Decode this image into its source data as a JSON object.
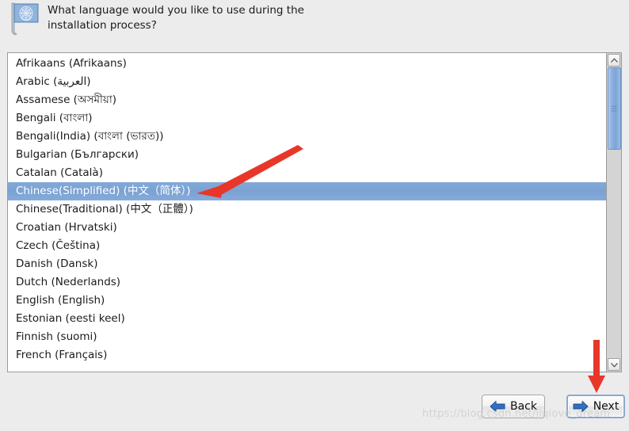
{
  "window": {
    "background_color": "#ececec"
  },
  "header": {
    "icon": "un-flag-icon",
    "prompt": "What language would you like to use during the installation process?"
  },
  "language_list": {
    "name": "language-selection-list",
    "selected_value": "Chinese(Simplified) (中文（简体）)",
    "items": [
      {
        "label": "Afrikaans (Afrikaans)",
        "selected": false
      },
      {
        "label": "Arabic (العربية)",
        "selected": false
      },
      {
        "label": "Assamese (অসমীয়া)",
        "selected": false
      },
      {
        "label": "Bengali (বাংলা)",
        "selected": false
      },
      {
        "label": "Bengali(India) (বাংলা (ভারত))",
        "selected": false
      },
      {
        "label": "Bulgarian (Български)",
        "selected": false
      },
      {
        "label": "Catalan (Català)",
        "selected": false
      },
      {
        "label": "Chinese(Simplified) (中文（简体）)",
        "selected": true
      },
      {
        "label": "Chinese(Traditional) (中文（正體）)",
        "selected": false
      },
      {
        "label": "Croatian (Hrvatski)",
        "selected": false
      },
      {
        "label": "Czech (Čeština)",
        "selected": false
      },
      {
        "label": "Danish (Dansk)",
        "selected": false
      },
      {
        "label": "Dutch (Nederlands)",
        "selected": false
      },
      {
        "label": "English (English)",
        "selected": false
      },
      {
        "label": "Estonian (eesti keel)",
        "selected": false
      },
      {
        "label": "Finnish (suomi)",
        "selected": false
      },
      {
        "label": "French (Français)",
        "selected": false
      }
    ],
    "selection_color": "#7ba2d4"
  },
  "scrollbar": {
    "up_arrow": "chevron-up-icon",
    "down_arrow": "chevron-down-icon",
    "thumb_color": "#7ba4da",
    "position_percent": 0
  },
  "buttons": {
    "back": {
      "label": "Back",
      "icon": "arrow-left-icon"
    },
    "next": {
      "label": "Next",
      "icon": "arrow-right-icon",
      "focused": true
    }
  },
  "annotations": {
    "color": "#e8372a",
    "arrow_to_selected_row": "diagonal-red-arrow-pointing-to-selected-language",
    "arrow_to_next_button": "vertical-red-arrow-pointing-to-next-button"
  },
  "watermark": {
    "text": "https://blog.csdn.net/jiqiove_dream"
  }
}
